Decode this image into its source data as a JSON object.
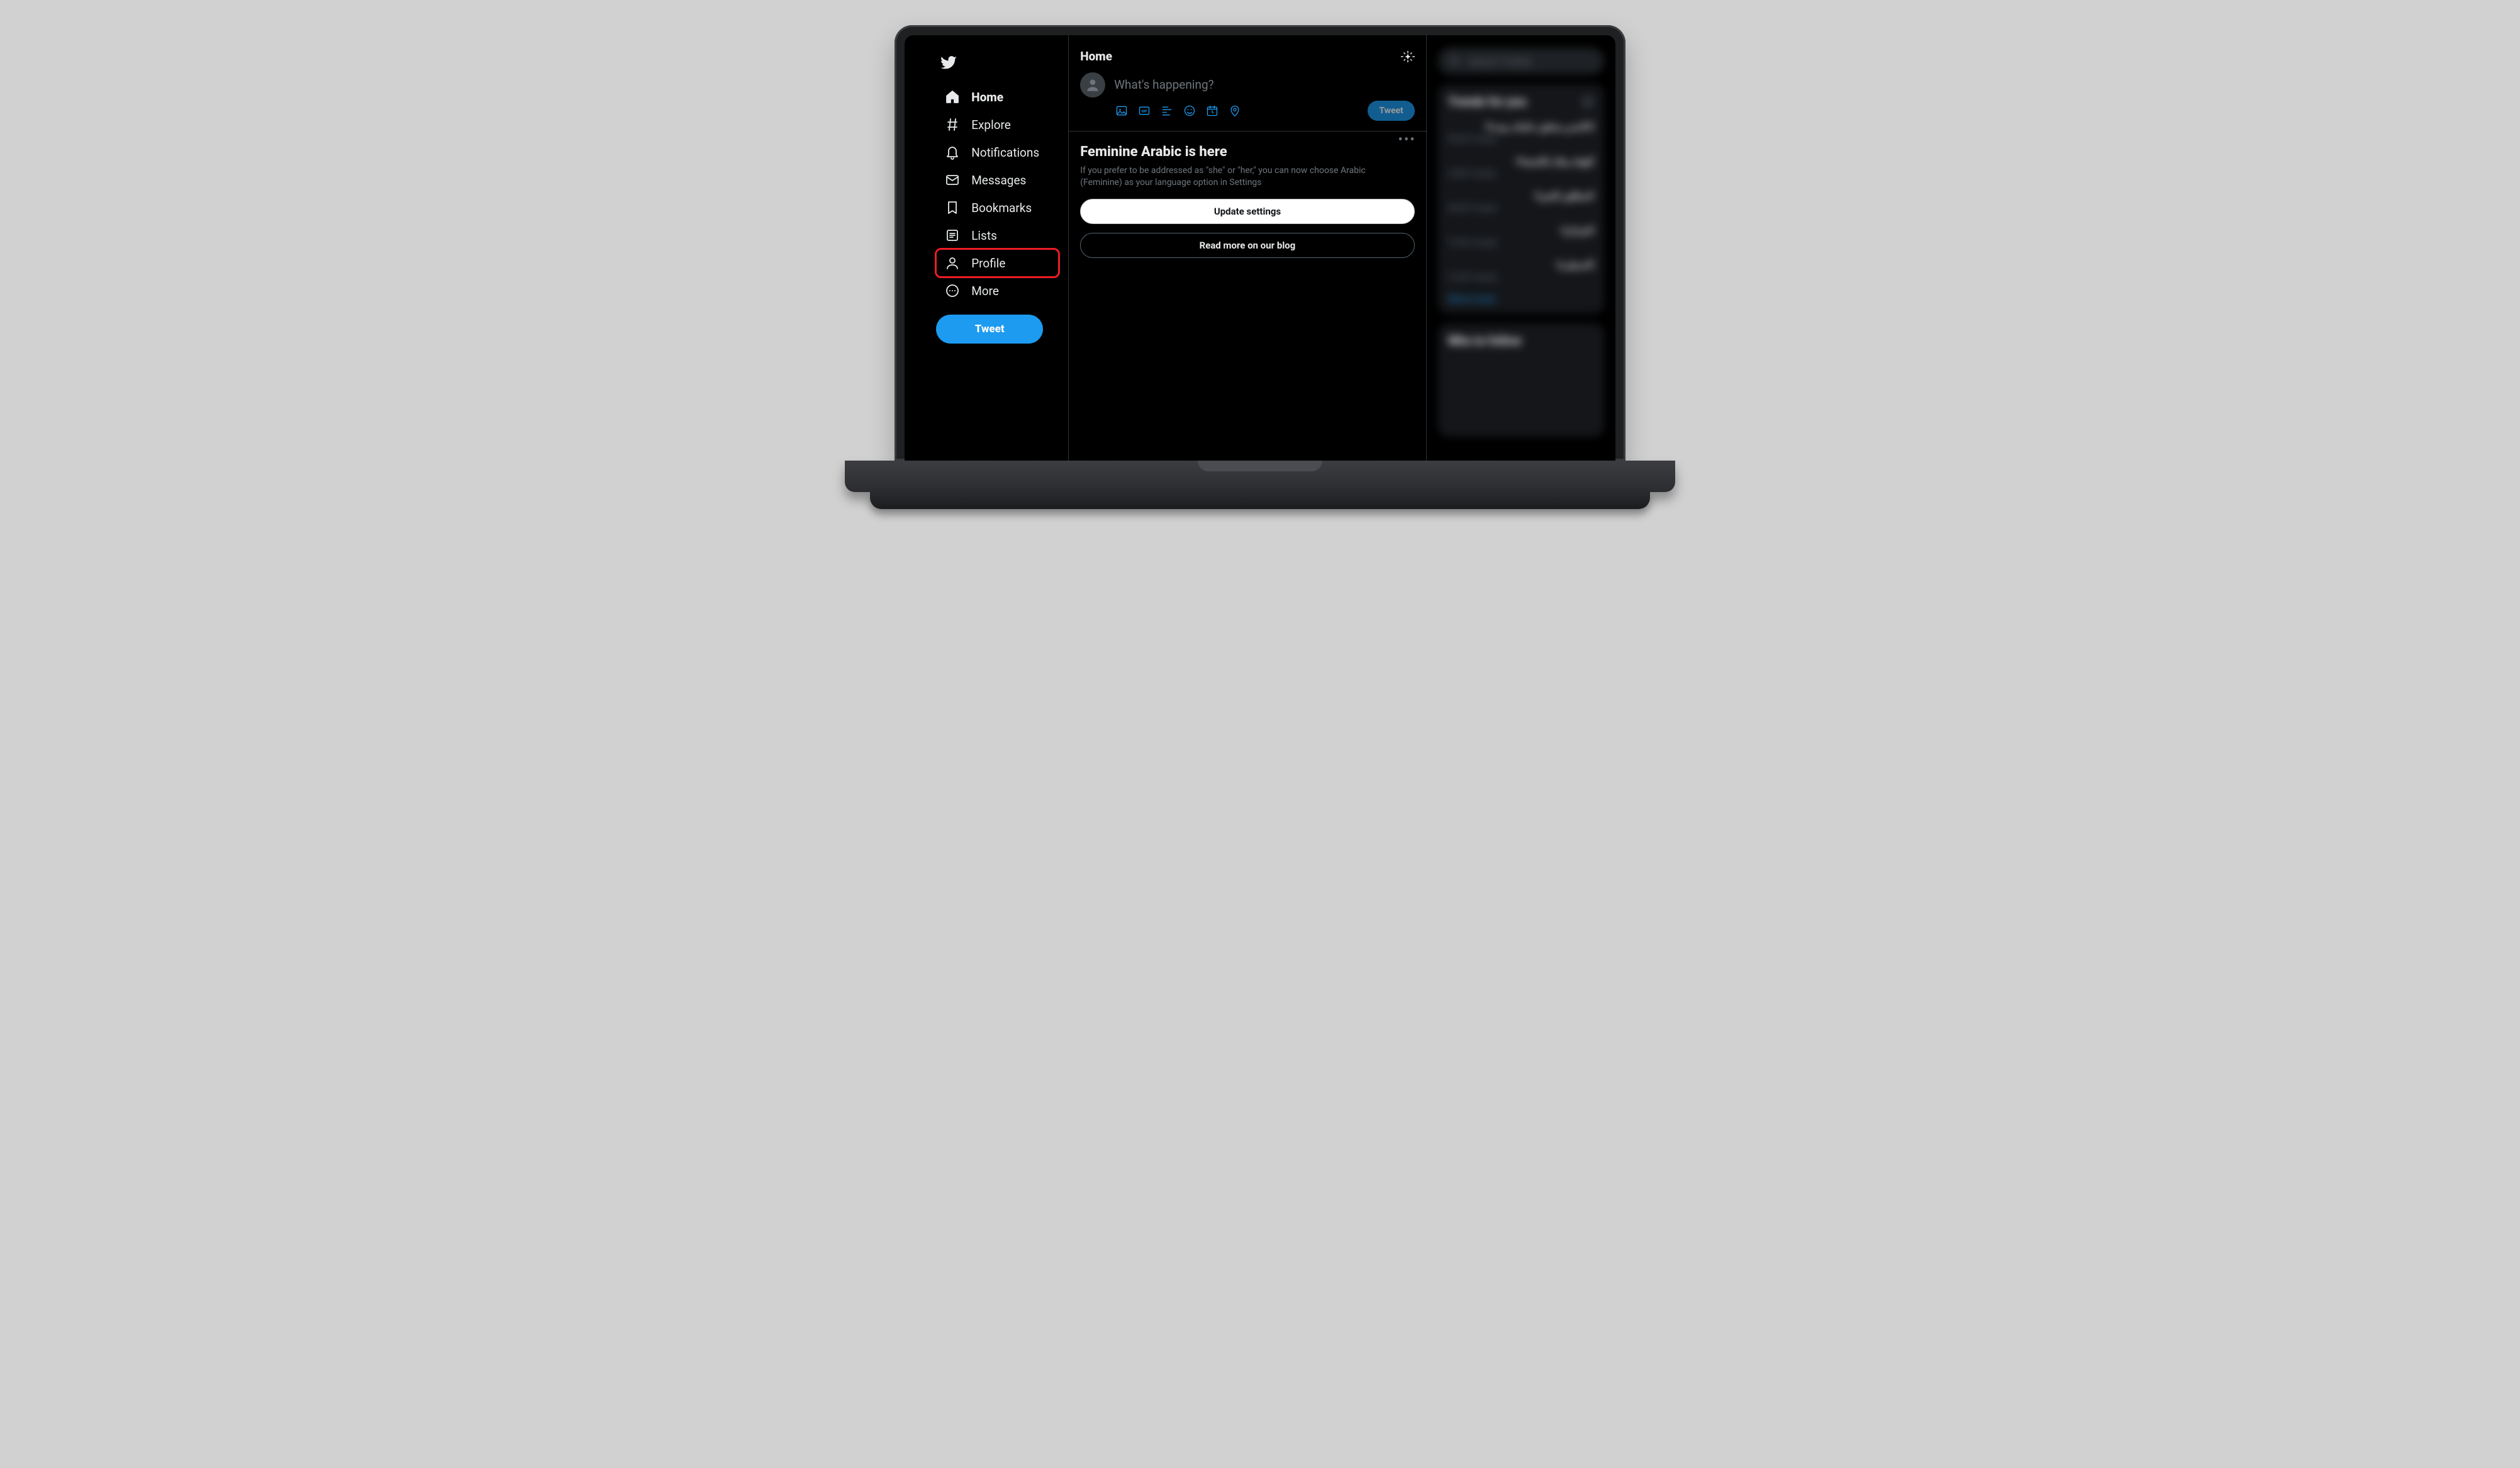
{
  "app_name": "Twitter",
  "sidebar": {
    "items": [
      {
        "label": "Home",
        "icon": "home",
        "active": true
      },
      {
        "label": "Explore",
        "icon": "hash"
      },
      {
        "label": "Notifications",
        "icon": "bell"
      },
      {
        "label": "Messages",
        "icon": "mail"
      },
      {
        "label": "Bookmarks",
        "icon": "bookmark"
      },
      {
        "label": "Lists",
        "icon": "list"
      },
      {
        "label": "Profile",
        "icon": "user",
        "highlight": true
      },
      {
        "label": "More",
        "icon": "dots"
      }
    ],
    "tweet_button_label": "Tweet"
  },
  "timeline": {
    "header_title": "Home",
    "compose_placeholder": "What's happening?",
    "compose_icons": [
      "image-icon",
      "gif-icon",
      "poll-icon",
      "emoji-icon",
      "schedule-icon",
      "location-icon"
    ],
    "compose_tweet_label": "Tweet",
    "promo": {
      "title": "Feminine Arabic is here",
      "body": "If you prefer to be addressed as \"she\" or \"her,\" you can now choose Arabic (Feminine) as your language option in Settings",
      "primary_button": "Update settings",
      "secondary_button": "Read more on our blog"
    }
  },
  "right_rail": {
    "search_placeholder": "Search Twitter",
    "trends_title": "Trends for you",
    "trends": [
      {
        "title": "#اتاكسي_يحقق_حلمك_ببيت",
        "count": "98.9K Tweets"
      },
      {
        "title": "#الهيئة_بيتك_للتعمية",
        "count": "4,380 Tweets"
      },
      {
        "title": "#المطلق_الخير",
        "count": "48.9K Tweets"
      },
      {
        "title": "#الجزائر",
        "count": "79.9K Tweets"
      },
      {
        "title": "#الاسطى",
        "count": "16.9K Tweets"
      }
    ],
    "show_more": "Show more",
    "who_to_follow_title": "Who to follow"
  },
  "colors": {
    "accent": "#1d9bf0",
    "highlight_box": "#ed1c24"
  }
}
